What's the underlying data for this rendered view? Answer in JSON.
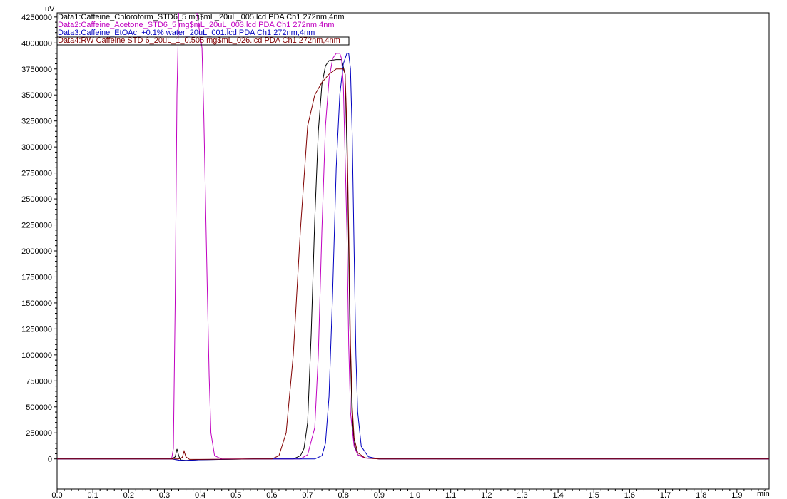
{
  "chart_data": {
    "type": "line",
    "title": "",
    "xlabel": "min",
    "ylabel": "uV",
    "xlim": [
      0.0,
      1.99
    ],
    "ylim": [
      -290000,
      4290000
    ],
    "grid": false,
    "legend_placement": "top-left",
    "x_ticks": [
      "0.0",
      "0.1",
      "0.2",
      "0.3",
      "0.4",
      "0.5",
      "0.6",
      "0.7",
      "0.8",
      "0.9",
      "1.0",
      "1.1",
      "1.2",
      "1.3",
      "1.4",
      "1.5",
      "1.6",
      "1.7",
      "1.8",
      "1.9"
    ],
    "y_ticks": [
      "0",
      "250000",
      "500000",
      "750000",
      "1000000",
      "1250000",
      "1500000",
      "1750000",
      "2000000",
      "2250000",
      "2500000",
      "2750000",
      "3000000",
      "3250000",
      "3500000",
      "3750000",
      "4000000",
      "4250000"
    ],
    "series": [
      {
        "name": "Data1:Caffeine_Chloroform_STD6_5 mg$mL_20uL_005.lcd PDA Ch1 272nm,4nm",
        "color": "#000000",
        "x": [
          0.0,
          0.32,
          0.33,
          0.335,
          0.34,
          0.345,
          0.36,
          0.4,
          0.55,
          0.66,
          0.68,
          0.69,
          0.7,
          0.71,
          0.72,
          0.73,
          0.74,
          0.75,
          0.76,
          0.78,
          0.795,
          0.805,
          0.812,
          0.818,
          0.824,
          0.83,
          0.84,
          0.86,
          0.9,
          1.0,
          1.99
        ],
        "y": [
          0,
          0,
          20000,
          95000,
          30000,
          -10000,
          -15000,
          -8000,
          0,
          0,
          30000,
          100000,
          350000,
          1200000,
          2300000,
          3150000,
          3600000,
          3780000,
          3830000,
          3840000,
          3840000,
          3700000,
          2700000,
          1300000,
          450000,
          150000,
          40000,
          10000,
          0,
          0,
          0
        ]
      },
      {
        "name": "Data2:Caffeine_Acetone_STD6_5 mg$mL_20uL_003.lcd PDA Ch1 272nm,4nm",
        "color": "#c000c0",
        "x": [
          0.0,
          0.32,
          0.325,
          0.33,
          0.335,
          0.34,
          0.39,
          0.405,
          0.41,
          0.42,
          0.425,
          0.43,
          0.44,
          0.46,
          0.6,
          0.68,
          0.7,
          0.72,
          0.73,
          0.74,
          0.75,
          0.76,
          0.77,
          0.78,
          0.79,
          0.795,
          0.8,
          0.81,
          0.815,
          0.82,
          0.83,
          0.84,
          0.86,
          0.9,
          1.99
        ],
        "y": [
          0,
          0,
          100000,
          1500000,
          3500000,
          4300000,
          4300000,
          3950000,
          3300000,
          1600000,
          800000,
          250000,
          30000,
          0,
          0,
          0,
          40000,
          300000,
          1000000,
          2200000,
          3200000,
          3650000,
          3850000,
          3900000,
          3900000,
          3850000,
          3600000,
          2200000,
          1100000,
          450000,
          120000,
          40000,
          8000,
          0,
          0
        ]
      },
      {
        "name": "Data3:Caffeine_EtOAc_+0.1% water_20uL_001.lcd PDA Ch1 272nm,4nm",
        "color": "#0000c0",
        "x": [
          0.0,
          0.32,
          0.34,
          0.36,
          0.4,
          0.55,
          0.72,
          0.74,
          0.75,
          0.76,
          0.77,
          0.78,
          0.79,
          0.8,
          0.81,
          0.815,
          0.82,
          0.825,
          0.83,
          0.835,
          0.84,
          0.85,
          0.87,
          0.9,
          1.99
        ],
        "y": [
          0,
          0,
          -12000,
          -15000,
          -8000,
          0,
          0,
          30000,
          150000,
          600000,
          1600000,
          2800000,
          3500000,
          3800000,
          3900000,
          3900000,
          3750000,
          3100000,
          2000000,
          1000000,
          450000,
          120000,
          20000,
          0,
          0
        ]
      },
      {
        "name": "Data4:RW   Caffeine STD 6_20uL_1_0.505 mg$mL_026.lcd PDA Ch1 272nm,4nm",
        "color": "#800000",
        "x": [
          0.0,
          0.34,
          0.35,
          0.355,
          0.36,
          0.37,
          0.4,
          0.55,
          0.6,
          0.62,
          0.64,
          0.66,
          0.68,
          0.7,
          0.72,
          0.74,
          0.76,
          0.78,
          0.8,
          0.805,
          0.81,
          0.815,
          0.82,
          0.825,
          0.83,
          0.84,
          0.86,
          0.9,
          1.99
        ],
        "y": [
          0,
          0,
          15000,
          75000,
          20000,
          -5000,
          -5000,
          0,
          0,
          30000,
          250000,
          1000000,
          2200000,
          3200000,
          3500000,
          3620000,
          3700000,
          3750000,
          3750000,
          3700000,
          3200000,
          2200000,
          1100000,
          500000,
          200000,
          60000,
          10000,
          0,
          0
        ]
      }
    ]
  }
}
